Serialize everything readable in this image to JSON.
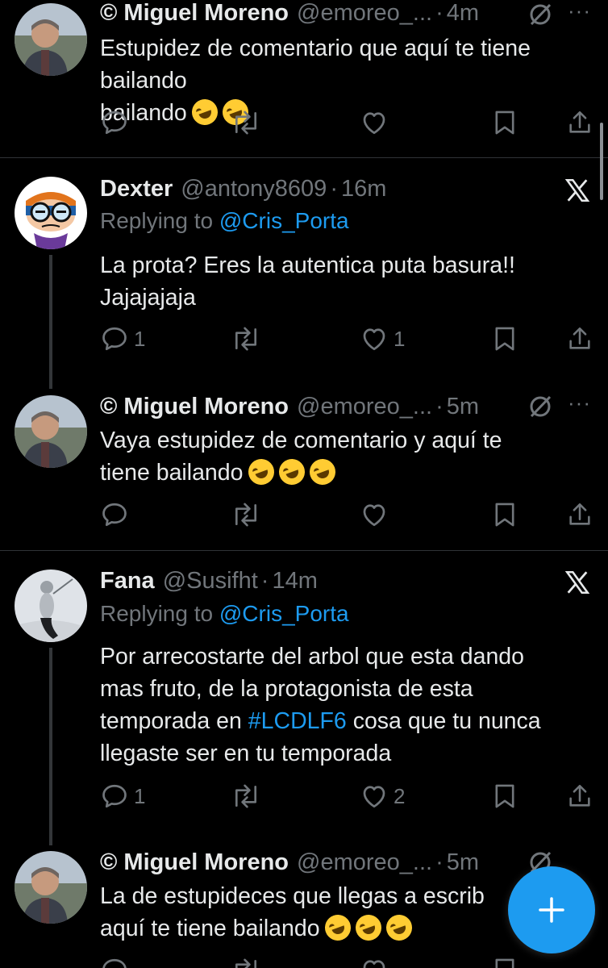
{
  "tweets": [
    {
      "name": "© Miguel Moreno",
      "handle": "@emoreo_...",
      "time": "4m",
      "text": "Estupidez de comentario que aquí te tiene bailando",
      "emoji_count": 2,
      "actions": {
        "reply": "",
        "retweet": "",
        "like": ""
      }
    },
    {
      "name": "Dexter",
      "handle": "@antony8609",
      "time": "16m",
      "replying_prefix": "Replying to",
      "replying_to": "@Cris_Porta",
      "text_line1": "La prota? Eres la autentica puta basura!!",
      "text_line2": "Jajajajaja",
      "actions": {
        "reply": "1",
        "retweet": "",
        "like": "1"
      }
    },
    {
      "name": "© Miguel Moreno",
      "handle": "@emoreo_...",
      "time": "5m",
      "text_line1": "Vaya estupidez de comentario y aquí te",
      "text_line2": "tiene bailando",
      "emoji_count": 3,
      "actions": {
        "reply": "",
        "retweet": "",
        "like": ""
      }
    },
    {
      "name": "Fana",
      "handle": "@Susifht",
      "time": "14m",
      "replying_prefix": "Replying to",
      "replying_to": "@Cris_Porta",
      "text_line1": "Por arrecostarte del arbol que esta dando",
      "text_line2": "mas fruto, de la protagonista de esta",
      "text_line3_a": "temporada en ",
      "hashtag": "#LCDLF6",
      "text_line3_b": " cosa que tu nunca",
      "text_line4": "llegaste ser en tu temporada",
      "actions": {
        "reply": "1",
        "retweet": "",
        "like": "2"
      }
    },
    {
      "name": "© Miguel Moreno",
      "handle": "@emoreo_...",
      "time": "5m",
      "text_line1": "La de estupideces que llegas a escrib",
      "text_line2": "aquí te tiene bailando",
      "emoji_count": 3
    }
  ],
  "dot_sep": "·",
  "more_label": "···",
  "compose_button": "+",
  "colors": {
    "background": "#000000",
    "text": "#e7e9ea",
    "muted": "#71767b",
    "accent": "#1d9bf0",
    "divider": "#2f3336"
  },
  "icons": {
    "reply": "reply-icon",
    "retweet": "retweet-icon",
    "like": "heart-icon",
    "bookmark": "bookmark-icon",
    "share": "share-icon",
    "grok": "grok-icon",
    "x_logo": "x-logo-icon",
    "emoji": "rolling-laughing-emoji"
  }
}
